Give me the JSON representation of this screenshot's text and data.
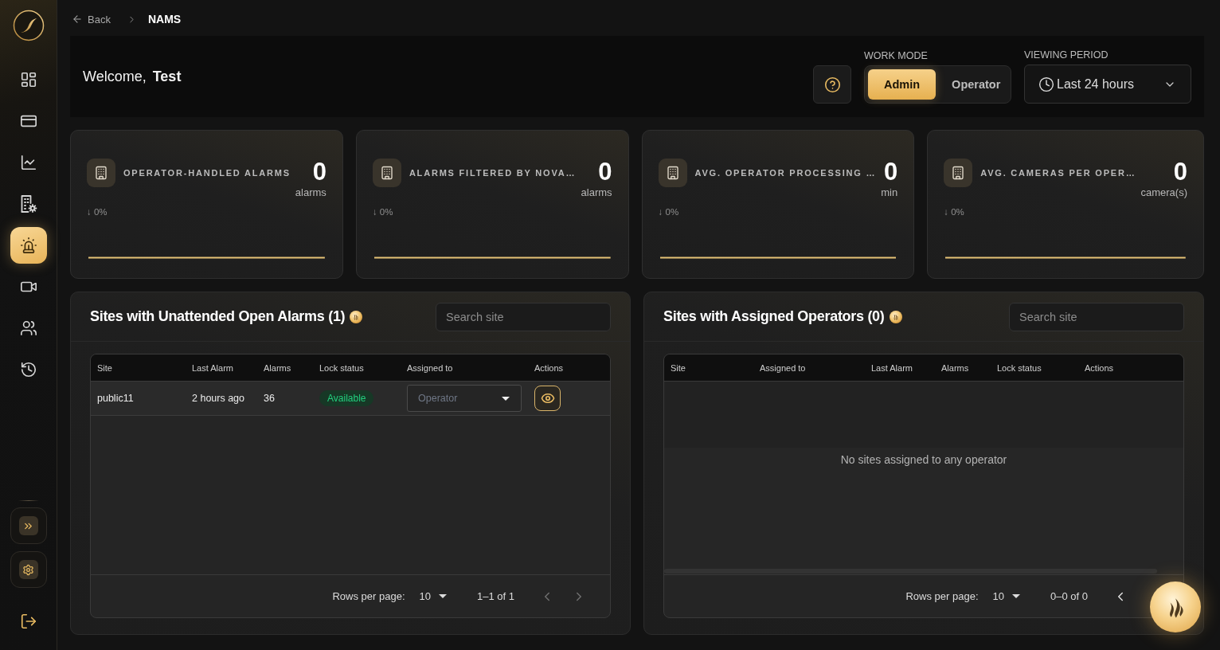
{
  "sidebar": {
    "items": [
      {
        "selected": false
      },
      {
        "selected": false
      },
      {
        "selected": false
      },
      {
        "selected": false
      },
      {
        "selected": true
      },
      {
        "selected": false
      },
      {
        "selected": false
      },
      {
        "selected": false
      }
    ]
  },
  "breadcrumb": {
    "back": "Back",
    "current": "NAMS"
  },
  "header": {
    "welcome": "Welcome, **Test**",
    "work_mode": {
      "label": "WORK MODE",
      "options": [
        {
          "label": "Admin",
          "selected": true
        },
        {
          "label": "Operator",
          "selected": false
        }
      ]
    },
    "viewing_period": {
      "label": "VIEWING PERIOD",
      "value": "Last 24 hours"
    }
  },
  "stats": [
    {
      "title": "OPERATOR-HANDLED ALARMS",
      "value": "0",
      "unit": "alarms",
      "change": "↓ 0%"
    },
    {
      "title": "ALARMS FILTERED BY NOVA…",
      "value": "0",
      "unit": "alarms",
      "change": "↓ 0%"
    },
    {
      "title": "AVG. OPERATOR PROCESSING …",
      "value": "0",
      "unit": "min",
      "change": "↓ 0%"
    },
    {
      "title": "AVG. CAMERAS PER OPER…",
      "value": "0",
      "unit": "camera(s)",
      "change": "↓ 0%"
    }
  ],
  "panels": [
    {
      "title": "Sites with Unattended Open Alarms (1)",
      "search": {
        "placeholder": "Search site"
      },
      "table": {
        "columns": [
          "Site",
          "Last Alarm",
          "Alarms",
          "Lock status",
          "Assigned to",
          "Actions"
        ],
        "rows": [
          {
            "cells": [
              {
                "kind": "text",
                "text": "public11"
              },
              {
                "kind": "text",
                "text": "2 hours ago"
              },
              {
                "kind": "text",
                "text": "36"
              },
              {
                "kind": "status",
                "text": "Available"
              },
              {
                "kind": "select",
                "placeholder": "Operator"
              },
              {
                "kind": "actions"
              }
            ]
          }
        ]
      },
      "pagination": {
        "rows_label": "Rows per page:",
        "rows_per_page": "10",
        "range": "1–1 of 1",
        "buttons": [
          {
            "kind": "prev",
            "disabled": true
          },
          {
            "kind": "next",
            "disabled": true
          }
        ]
      }
    },
    {
      "title": "Sites with Assigned Operators (0)",
      "search": {
        "placeholder": "Search site"
      },
      "table": {
        "columns": [
          "Site",
          "Assigned to",
          "Last Alarm",
          "Alarms",
          "Lock status",
          "Actions"
        ],
        "empty_message": "No sites assigned to any operator"
      },
      "pagination": {
        "rows_label": "Rows per page:",
        "rows_per_page": "10",
        "range": "0–0 of 0",
        "buttons": [
          {
            "kind": "prev",
            "disabled": false
          }
        ]
      }
    }
  ]
}
